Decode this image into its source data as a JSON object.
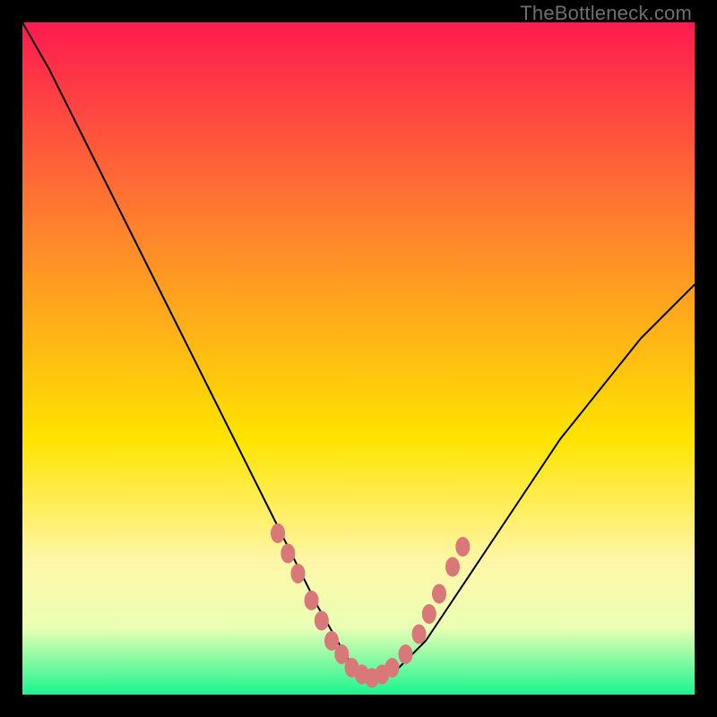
{
  "watermark": "TheBottleneck.com",
  "colors": {
    "top": "#ff1a4f",
    "mid_upper": "#ff8a2a",
    "mid": "#ffe400",
    "soft_yellow": "#fff6a6",
    "pale": "#eaffb5",
    "bottom": "#1cf48f",
    "bead": "#d87878",
    "curve": "#000000",
    "frame": "#000000"
  },
  "chart_data": {
    "type": "line",
    "title": "",
    "xlabel": "",
    "ylabel": "",
    "xlim": [
      0,
      100
    ],
    "ylim": [
      0,
      100
    ],
    "series": [
      {
        "name": "curve",
        "x": [
          0,
          4,
          8,
          12,
          16,
          20,
          24,
          28,
          32,
          36,
          40,
          44,
          48,
          50,
          52,
          56,
          60,
          64,
          68,
          72,
          76,
          80,
          84,
          88,
          92,
          96,
          100
        ],
        "values": [
          100,
          93,
          85,
          77,
          69,
          61,
          53,
          45,
          37,
          29,
          21,
          13,
          6,
          3,
          2,
          4,
          8,
          14,
          20,
          26,
          32,
          38,
          43,
          48,
          53,
          57,
          61
        ]
      }
    ],
    "beads": {
      "name": "highlight-points",
      "x": [
        38,
        39.5,
        41,
        43,
        44.5,
        46,
        47.5,
        49,
        50.5,
        52,
        53.5,
        55,
        57,
        59,
        60.5,
        62,
        64,
        65.5
      ],
      "values": [
        24,
        21,
        18,
        14,
        11,
        8,
        6,
        4,
        3,
        2.5,
        3,
        4,
        6,
        9,
        12,
        15,
        19,
        22
      ]
    },
    "gradient_stops": [
      {
        "offset": 0.0,
        "color": "#ff1a4f"
      },
      {
        "offset": 0.33,
        "color": "#ff8a2a"
      },
      {
        "offset": 0.62,
        "color": "#ffe400"
      },
      {
        "offset": 0.8,
        "color": "#fff6a6"
      },
      {
        "offset": 0.9,
        "color": "#eaffb5"
      },
      {
        "offset": 1.0,
        "color": "#1cf48f"
      }
    ]
  }
}
